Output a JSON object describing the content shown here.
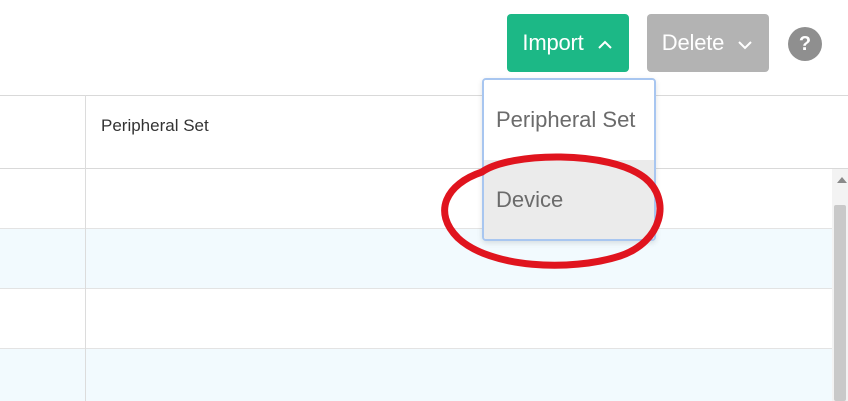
{
  "toolbar": {
    "import_label": "Import",
    "delete_label": "Delete",
    "help_label": "?",
    "import_color": "#1cb886",
    "delete_color": "#b3b3b3"
  },
  "table": {
    "columns": [
      "",
      "Peripheral Set"
    ],
    "rows": [
      [
        "",
        ""
      ],
      [
        "",
        ""
      ],
      [
        "",
        ""
      ],
      [
        "",
        ""
      ]
    ]
  },
  "import_menu": {
    "items": [
      {
        "label": "Peripheral Set",
        "highlighted": false
      },
      {
        "label": "Device",
        "highlighted": true
      }
    ]
  },
  "annotation": {
    "shape": "ellipse",
    "color": "#e0141e",
    "target": "Device"
  },
  "icons": {
    "import_chevron": "chevron-up-icon",
    "delete_chevron": "chevron-down-icon",
    "help": "help-icon",
    "scroll_up": "scroll-up-arrow-icon"
  }
}
